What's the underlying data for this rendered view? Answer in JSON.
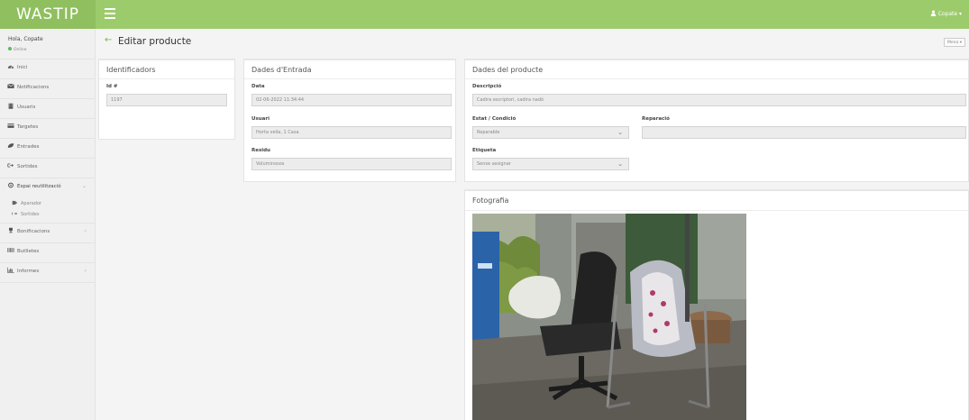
{
  "app": {
    "logo": "WASTIP",
    "user_label": "Copate",
    "colors": {
      "accent": "#9ccb6c",
      "accent_dark": "#7fb24e"
    }
  },
  "sidebar": {
    "greeting": "Hola, Copate",
    "status": "Online",
    "items": [
      {
        "label": "Inici",
        "icon": "dashboard-icon"
      },
      {
        "label": "Notificacions",
        "icon": "envelope-icon"
      },
      {
        "label": "Usuaris",
        "icon": "building-icon"
      },
      {
        "label": "Targetes",
        "icon": "card-icon"
      },
      {
        "label": "Entrades",
        "icon": "leaf-icon"
      },
      {
        "label": "Sortides",
        "icon": "sign-out-icon"
      },
      {
        "label": "Espai reutilització",
        "icon": "recycle-icon"
      },
      {
        "label": "Bonificacions",
        "icon": "trophy-icon"
      },
      {
        "label": "Butlletes",
        "icon": "barcode-icon"
      },
      {
        "label": "Informes",
        "icon": "bar-chart-icon"
      }
    ],
    "subitems": [
      {
        "label": "Aparador",
        "icon": "tag-icon"
      },
      {
        "label": "Sortides",
        "icon": "sign-out-icon"
      }
    ]
  },
  "header": {
    "title": "Editar producte",
    "menu_label": "Menú"
  },
  "identificadors": {
    "title": "Identificadors",
    "id_label": "Id #",
    "id_value": "1197"
  },
  "entrada": {
    "title": "Dades d'Entrada",
    "data_label": "Data",
    "data_value": "02-06-2022 11:34:44",
    "usuari_label": "Usuari",
    "usuari_value": "Horta vella, 1 Casa",
    "residu_label": "Residu",
    "residu_value": "Voluminosos"
  },
  "producte": {
    "title": "Dades del producte",
    "descripcio_label": "Descripció",
    "descripcio_value": "Cadira escriptori, cadira nadó",
    "estat_label": "Estat / Condició",
    "estat_value": "Reparable",
    "reparacio_label": "Reparació",
    "reparacio_value": "",
    "etiqueta_label": "Etiqueta",
    "etiqueta_value": "Sense assignar"
  },
  "fotografia": {
    "title": "Fotografia"
  }
}
